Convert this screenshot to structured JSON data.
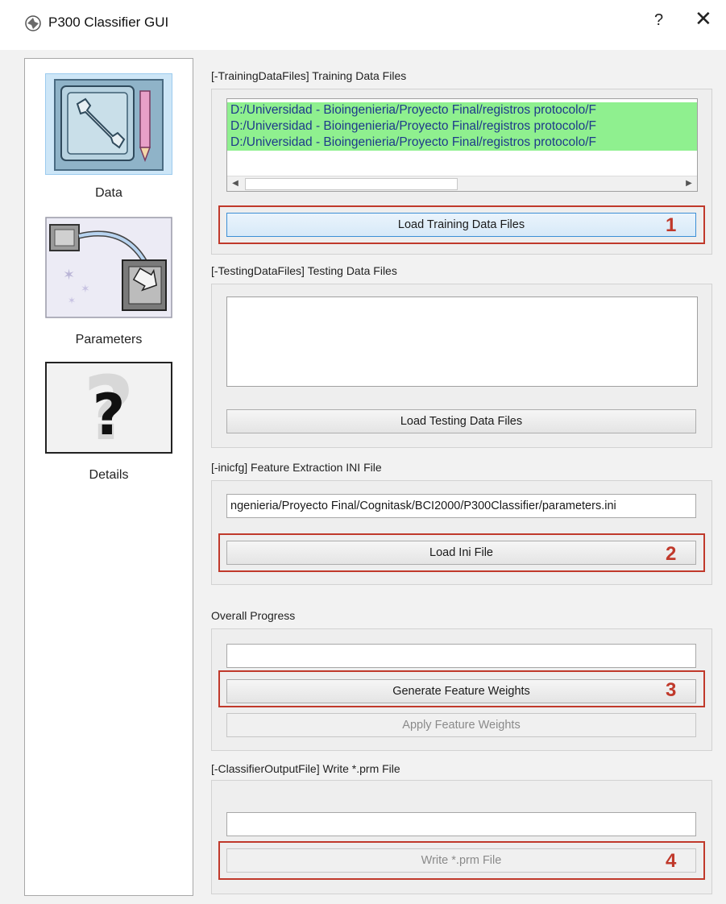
{
  "window": {
    "title": "P300 Classifier GUI",
    "help_label": "?",
    "close_label": "✕"
  },
  "nav": {
    "items": [
      {
        "label": "Data",
        "icon": "wrench-pencil-icon",
        "selected": true
      },
      {
        "label": "Parameters",
        "icon": "arrow-transfer-icon",
        "selected": false
      },
      {
        "label": "Details",
        "icon": "question-mark-icon",
        "selected": false
      }
    ]
  },
  "training": {
    "group_title": "[-TrainingDataFiles] Training Data Files",
    "files": [
      "D:/Universidad - Bioingenieria/Proyecto Final/registros protocolo/F",
      "D:/Universidad - Bioingenieria/Proyecto Final/registros protocolo/F",
      "D:/Universidad - Bioingenieria/Proyecto Final/registros protocolo/F"
    ],
    "load_button": "Load Training Data Files",
    "annotation": "1"
  },
  "testing": {
    "group_title": "[-TestingDataFiles] Testing Data Files",
    "load_button": "Load Testing Data Files"
  },
  "ini": {
    "group_title": "[-inicfg] Feature Extraction INI File",
    "path_value": "ngenieria/Proyecto Final/Cognitask/BCI2000/P300Classifier/parameters.ini",
    "load_button": "Load Ini File",
    "annotation": "2"
  },
  "progress": {
    "group_title": "Overall Progress",
    "generate_button": "Generate Feature Weights",
    "apply_button": "Apply Feature Weights",
    "annotation": "3"
  },
  "output": {
    "group_title": "[-ClassifierOutputFile] Write *.prm File",
    "write_button": "Write *.prm File",
    "annotation": "4"
  },
  "colors": {
    "highlight": "#c0392b",
    "selected_file_bg": "#8ff08f",
    "nav_selected_bg": "#cde6f7"
  }
}
